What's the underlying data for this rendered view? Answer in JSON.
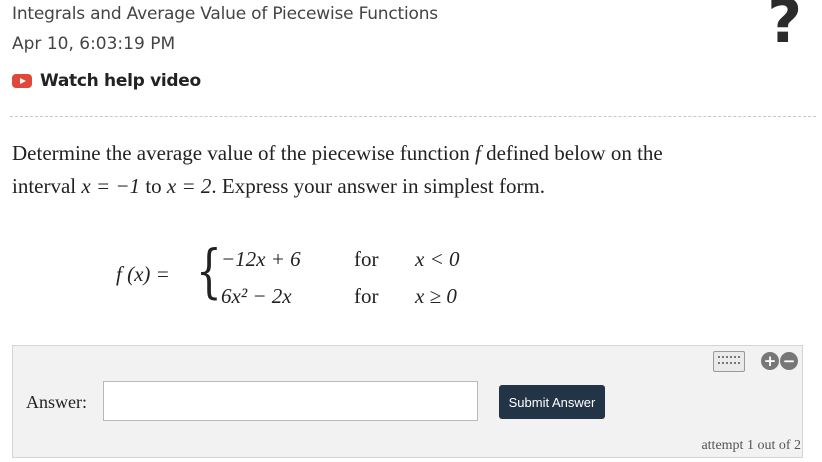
{
  "header": {
    "title": "Integrals and Average Value of Piecewise Functions",
    "date": "Apr 10, 6:03:19 PM",
    "help_link": "Watch help video",
    "help_icon": "video-play-icon",
    "help_mark": "?"
  },
  "question": {
    "line1_pre": "Determine the average value of the piecewise function ",
    "fn_name": "f",
    "line1_post": " defined below on the",
    "line2_pre": "interval ",
    "cond_a": "x = −1",
    "to": " to ",
    "cond_b": "x = 2",
    "line2_post": ". Express your answer in simplest form."
  },
  "piecewise": {
    "lhs": "f (x) =",
    "brace": "{",
    "rows": [
      {
        "expr": "−12x + 6",
        "word": "for",
        "cond": "x < 0"
      },
      {
        "expr": "6x² − 2x",
        "word": "for",
        "cond": "x ≥ 0"
      }
    ]
  },
  "answer": {
    "label": "Answer:",
    "input_value": "",
    "submit_label": "Submit Answer",
    "attempt_text": "attempt 1 out of 2",
    "keyboard_icon": "keyboard-icon",
    "plus_label": "+",
    "minus_label": "−"
  },
  "colors": {
    "accent_button": "#233447",
    "help_icon_red": "#e0483a"
  }
}
